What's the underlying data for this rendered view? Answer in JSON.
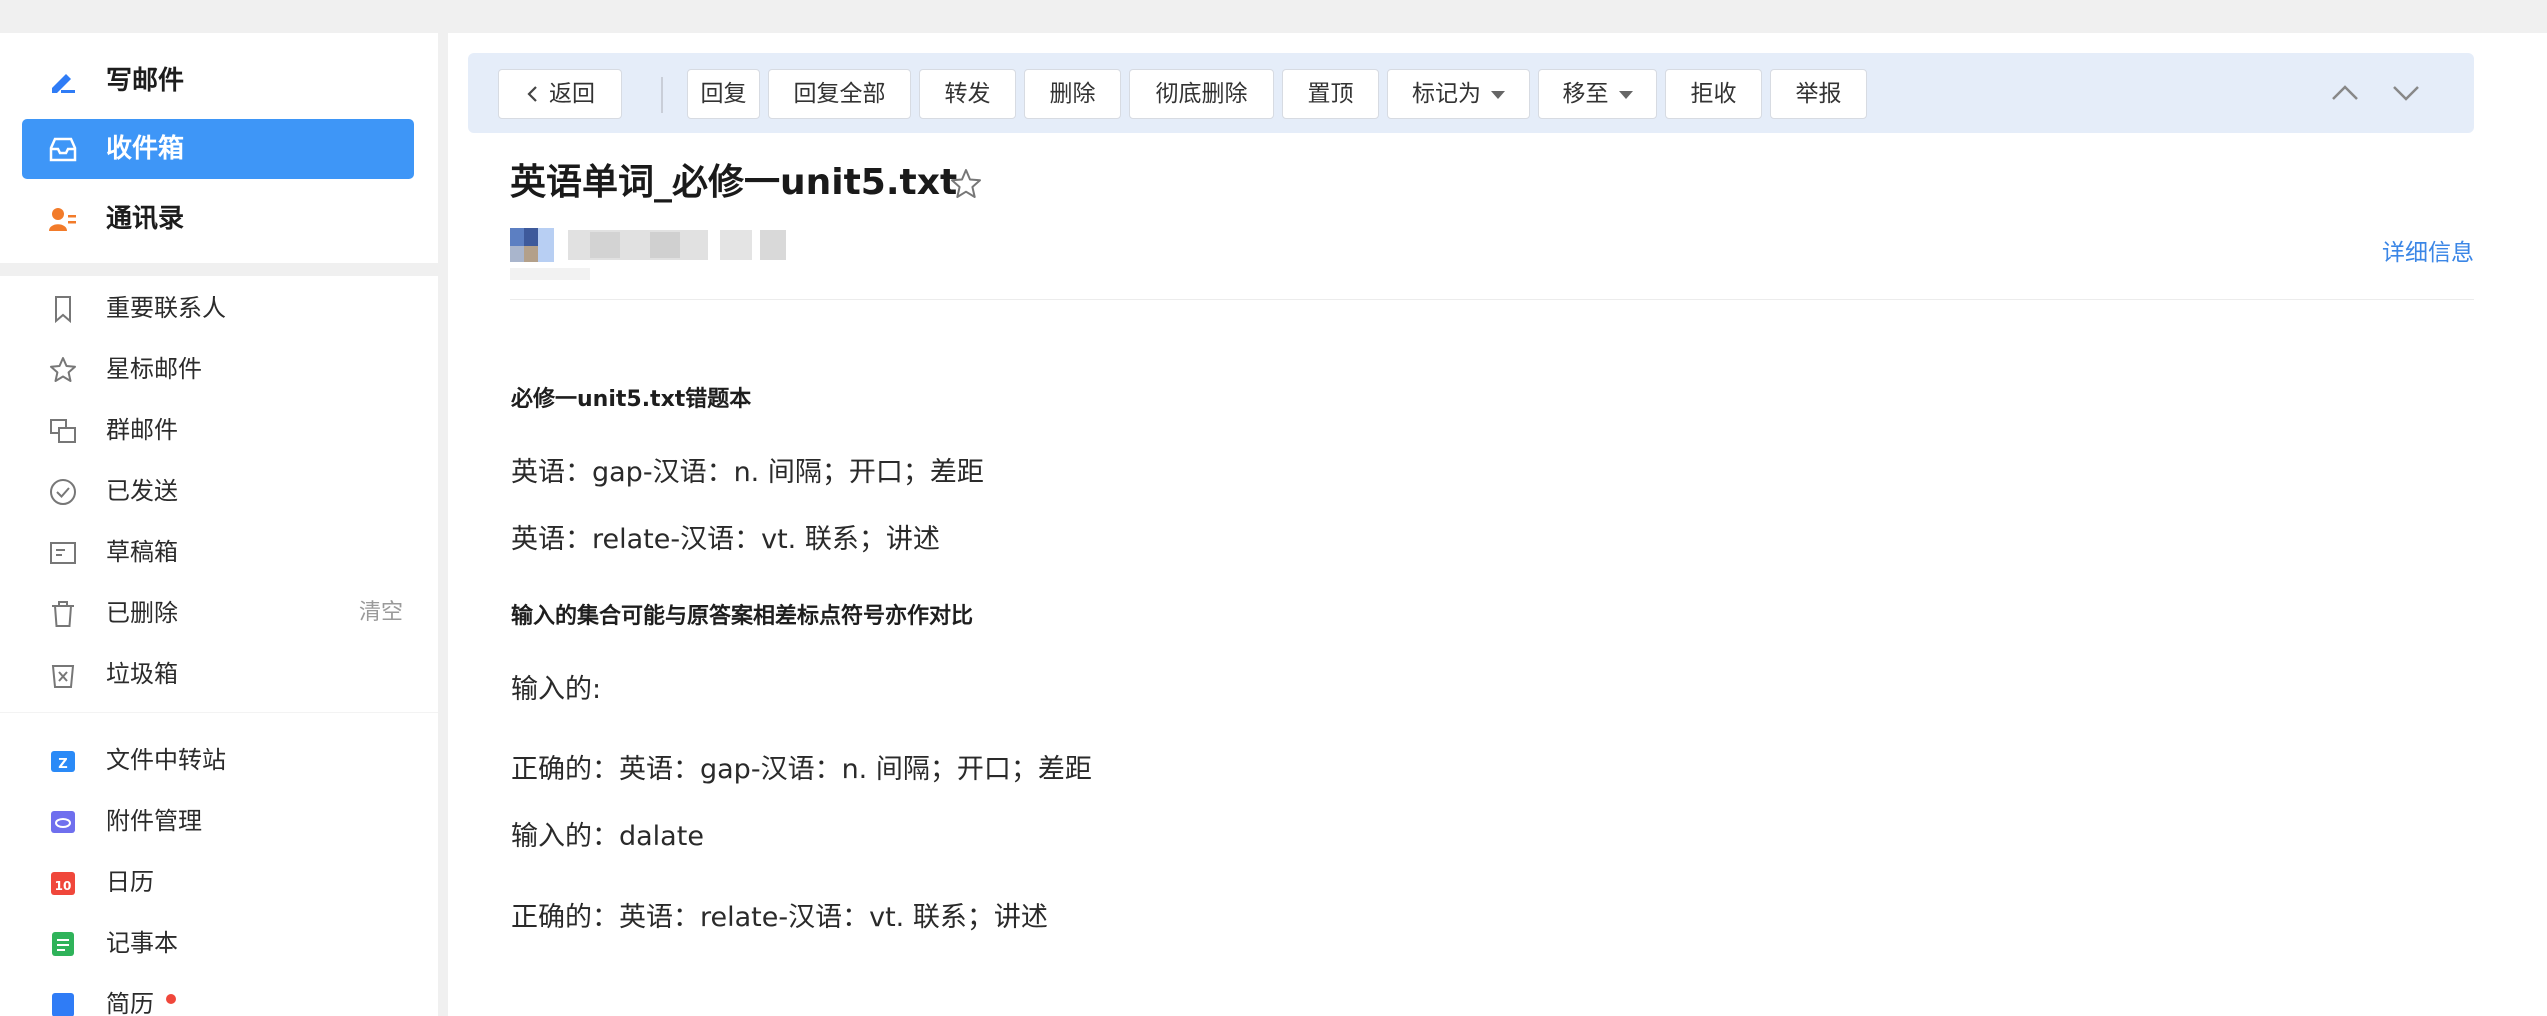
{
  "sidebar": {
    "main_items": [
      {
        "label": "写邮件",
        "icon": "pen-icon"
      },
      {
        "label": "收件箱",
        "icon": "inbox-icon",
        "active": true
      },
      {
        "label": "通讯录",
        "icon": "contacts-icon"
      }
    ],
    "folders": [
      {
        "label": "重要联系人",
        "icon": "bookmark-icon"
      },
      {
        "label": "星标邮件",
        "icon": "star-icon"
      },
      {
        "label": "群邮件",
        "icon": "group-mail-icon"
      },
      {
        "label": "已发送",
        "icon": "check-circle-icon"
      },
      {
        "label": "草稿箱",
        "icon": "draft-icon"
      },
      {
        "label": "已删除",
        "icon": "trash-icon",
        "extra": "清空"
      },
      {
        "label": "垃圾箱",
        "icon": "spam-icon"
      }
    ],
    "apps": [
      {
        "label": "文件中转站",
        "icon": "file-transfer-icon"
      },
      {
        "label": "附件管理",
        "icon": "attachment-icon"
      },
      {
        "label": "日历",
        "icon": "calendar-icon",
        "badge": "10"
      },
      {
        "label": "记事本",
        "icon": "notebook-icon"
      },
      {
        "label": "简历",
        "icon": "resume-icon"
      }
    ]
  },
  "toolbar": {
    "back": "返回",
    "buttons": [
      "回复",
      "回复全部",
      "转发",
      "删除",
      "彻底删除",
      "置顶",
      "标记为",
      "移至",
      "拒收",
      "举报"
    ]
  },
  "mail": {
    "subject": "英语单词_必修一unit5.txt",
    "detail_link": "详细信息",
    "body": [
      "必修一unit5.txt错题本",
      "英语：gap-汉语：n. 间隔；开口；差距",
      "英语：relate-汉语：vt. 联系；讲述",
      "输入的集合可能与原答案相差标点符号亦作对比",
      "输入的:",
      "正确的：英语：gap-汉语：n. 间隔；开口；差距",
      "输入的：dalate",
      "正确的：英语：relate-汉语：vt. 联系；讲述"
    ]
  },
  "colors": {
    "accent": "#3e96f7",
    "toolbar_bg": "#e5edf9",
    "link": "#3b86e6"
  }
}
